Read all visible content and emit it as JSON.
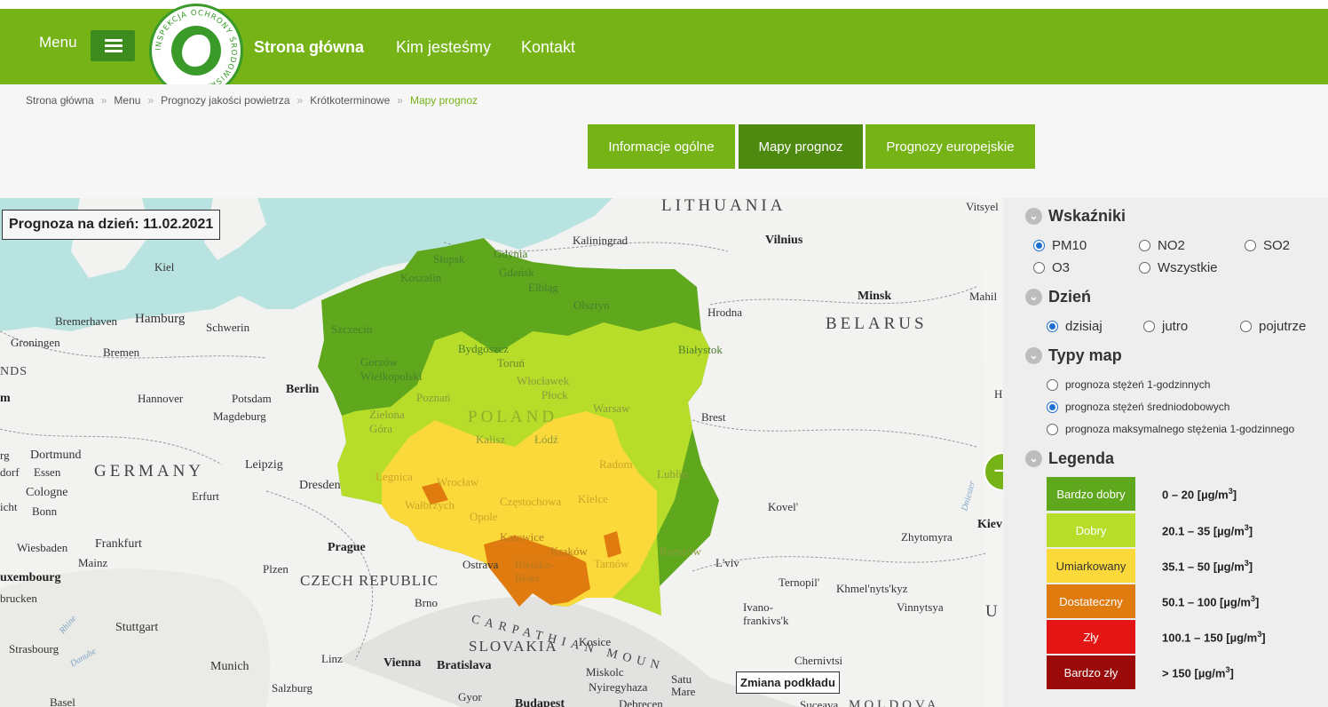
{
  "header": {
    "menu_label": "Menu",
    "logo_text": "INSPEKCJA OCHRONY ŚRODOWISKA",
    "nav": [
      "Strona główna",
      "Kim jesteśmy",
      "Kontakt"
    ]
  },
  "breadcrumb": [
    "Strona główna",
    "Menu",
    "Prognozy jakości powietrza",
    "Krótkoterminowe",
    "Mapy prognoz"
  ],
  "tabs": [
    "Informacje ogólne",
    "Mapy prognoz",
    "Prognozy europejskie"
  ],
  "map": {
    "date_label": "Prognoza na dzień: 11.02.2021",
    "basemap_button": "Zmiana podkładu",
    "labels": {
      "lithuania": "LITHUANIA",
      "kaliningrad": "Kaliningrad",
      "vilnius": "Vilnius",
      "minsk": "Minsk",
      "belarus": "BELARUS",
      "hrodna": "Hrodna",
      "brest": "Brest",
      "kovel": "Kovel'",
      "zhytomyra": "Zhytomyra",
      "lviv": "L'viv",
      "ternopil": "Ternopil'",
      "khmelnytskyi": "Khmel'nyts'kyz",
      "vinnytsya": "Vinnytsya",
      "ivano": "Ivano-",
      "frankivsk": "frankivs'k",
      "poland": "POLAND",
      "gdynia": "Gdynia",
      "gdansk": "Gdańsk",
      "slupsk": "Słupsk",
      "koszalin": "Koszalin",
      "elblag": "Elbląg",
      "olsztyn": "Olsztyn",
      "szczecin": "Szczecin",
      "bydgoszcz": "Bydgoszcz",
      "torun": "Toruń",
      "bialystok": "Białystok",
      "gorzow": "Gorzów",
      "wielkopolski": "Wielkopolski",
      "poznan": "Poznań",
      "wloclawek": "Włocławek",
      "plock": "Płock",
      "warsaw": "Warsaw",
      "zielona": "Zielona",
      "gora": "Góra",
      "kalisz": "Kalisz",
      "lodz": "Łódź",
      "radom": "Radom",
      "lublin": "Lublin",
      "legnica": "Legnica",
      "wroclaw": "Wrocław",
      "walbrzych": "Wałbrzych",
      "kielce": "Kielce",
      "czestochowa": "Częstochowa",
      "opole": "Opole",
      "katowice": "Katowice",
      "krakow": "Kraków",
      "tarnow": "Tarnów",
      "rzeszow": "Rzeszów",
      "ostrava": "Ostrava",
      "bielsko": "Bielsko-",
      "biala": "Biała",
      "germany": "GERMANY",
      "kiel": "Kiel",
      "hamburg": "Hamburg",
      "bremerhaven": "Bremerhaven",
      "schwerin": "Schwerin",
      "groningen": "Groningen",
      "bremen": "Bremen",
      "nds": "NDS",
      "m": "m",
      "hannover": "Hannover",
      "potsdam": "Potsdam",
      "berlin": "Berlin",
      "magdeburg": "Magdeburg",
      "rg": "rg",
      "dortmund": "Dortmund",
      "dorf": "dorf",
      "essen": "Essen",
      "cologne": "Cologne",
      "leipzig": "Leipzig",
      "icht": "icht",
      "bonn": "Bonn",
      "erfurt": "Erfurt",
      "dresden": "Dresden",
      "wiesbaden": "Wiesbaden",
      "frankfurt": "Frankfurt",
      "mainz": "Mainz",
      "prague": "Prague",
      "luxembourg": "uxembourg",
      "plzen": "Plzen",
      "czech": "CZECH REPUBLIC",
      "brucken": "brucken",
      "brno": "Brno",
      "stuttgart": "Stuttgart",
      "carpathian": "CARPATHIAN MOUN",
      "slovakia": "SLOVAKIA",
      "kosice": "Kosice",
      "strasbourg": "Strasbourg",
      "linz": "Linz",
      "munich": "Munich",
      "vienna": "Vienna",
      "bratislava": "Bratislava",
      "miskolc": "Miskolc",
      "nyiregyhaza": "Nyiregyhaza",
      "satu": "Satu",
      "mare": "Mare",
      "chernivtsi": "Chernivtsi",
      "salzburg": "Salzburg",
      "gyor": "Gyor",
      "basel": "Basel",
      "budapest": "Budapest",
      "debrecen": "Debrecen",
      "suceava": "Suceava",
      "moldova": "MOLDOVA",
      "vitsyel": "Vitsyel",
      "mahil": "Mahil",
      "u": "U",
      "kiev": "Kiev",
      "danube": "Danube",
      "rhine": "Rhine",
      "dniester": "Dniester",
      "h": "H"
    }
  },
  "panel": {
    "indicators": {
      "title": "Wskaźniki",
      "options": [
        "PM10",
        "NO2",
        "SO2",
        "O3",
        "Wszystkie"
      ],
      "selected": "PM10"
    },
    "day": {
      "title": "Dzień",
      "options": [
        "dzisiaj",
        "jutro",
        "pojutrze"
      ],
      "selected": "dzisiaj"
    },
    "map_types": {
      "title": "Typy map",
      "options": [
        "prognoza stężeń 1-godzinnych",
        "prognoza stężeń średniodobowych",
        "prognoza maksymalnego stężenia 1-godzinnego"
      ],
      "selected": "prognoza stężeń średniodobowych"
    },
    "legend": {
      "title": "Legenda",
      "items": [
        {
          "label": "Bardzo dobry",
          "range": "0 – 20 [µg/m",
          "color": "#5fa81e"
        },
        {
          "label": "Dobry",
          "range": "20.1 – 35 [µg/m",
          "color": "#b7dc2a"
        },
        {
          "label": "Umiarkowany",
          "range": "35.1 – 50 [µg/m",
          "color": "#fbd93a"
        },
        {
          "label": "Dostateczny",
          "range": "50.1 – 100 [µg/m",
          "color": "#e07b10"
        },
        {
          "label": "Zły",
          "range": "100.1 – 150 [µg/m",
          "color": "#e31515"
        },
        {
          "label": "Bardzo zły",
          "range": "> 150 [µg/m",
          "color": "#9a0a0a"
        }
      ],
      "unit_sup": "3",
      "unit_close": "]"
    }
  },
  "colors": {
    "brand_green": "#76b316",
    "active_tab": "#4f8a10",
    "sea": "#b9e3e1",
    "selected_radio": "#1a6fd1"
  }
}
